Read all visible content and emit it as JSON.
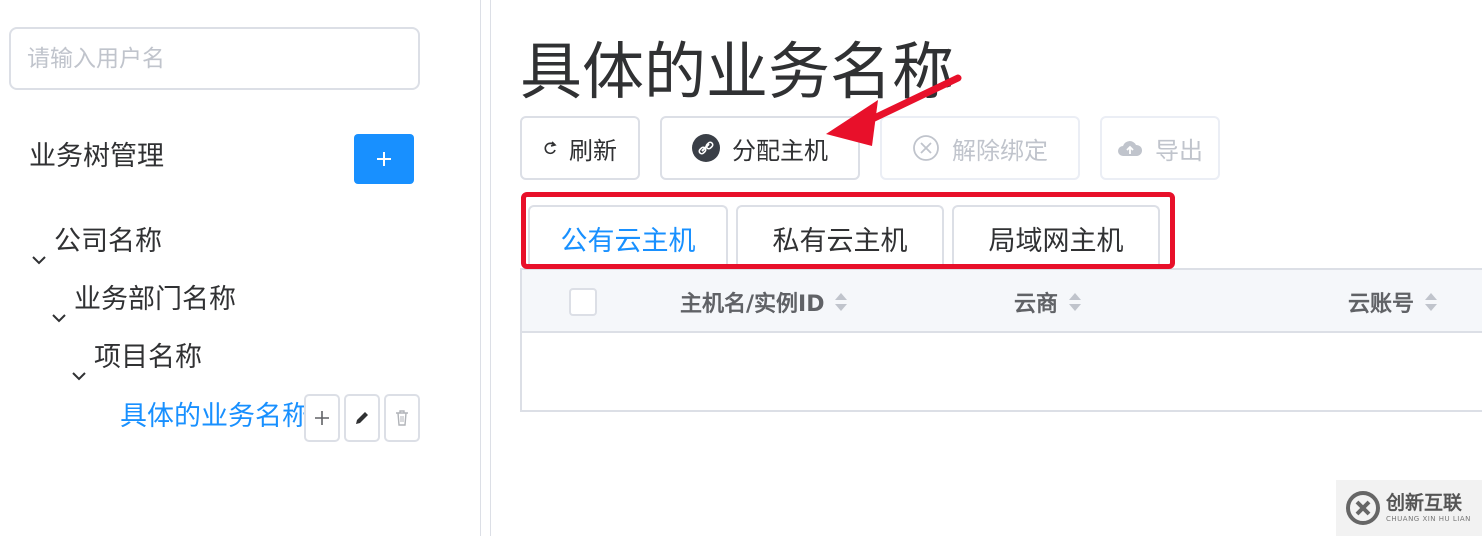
{
  "sidebar": {
    "search": {
      "placeholder": "请输入用户名",
      "value": ""
    },
    "tree_title": "业务树管理",
    "add_root_label": "+",
    "tree": [
      {
        "label": "公司名称",
        "expanded": true
      },
      {
        "label": "业务部门名称",
        "expanded": true
      },
      {
        "label": "项目名称",
        "expanded": true
      }
    ],
    "selected_leaf": {
      "label": "具体的业务名称"
    },
    "leaf_actions": {
      "add_label": "+"
    }
  },
  "main": {
    "title": "具体的业务名称",
    "toolbar": {
      "refresh_label": "刷新",
      "assign_label": "分配主机",
      "unbind_label": "解除绑定",
      "export_label": "导出"
    },
    "tabs": [
      {
        "label": "公有云主机",
        "active": true
      },
      {
        "label": "私有云主机",
        "active": false
      },
      {
        "label": "局域网主机",
        "active": false
      }
    ],
    "table": {
      "columns": [
        {
          "label": "主机名/实例ID",
          "sortable": true
        },
        {
          "label": "云商",
          "sortable": true
        },
        {
          "label": "云账号",
          "sortable": true
        }
      ],
      "rows": []
    }
  },
  "watermark": {
    "brand_cn": "创新互联",
    "brand_en": "CHUANG XIN HU LIAN"
  },
  "colors": {
    "accent": "#1890ff",
    "highlight": "#e8102a",
    "border": "#dcdfe6",
    "header_bg": "#f5f7fa"
  }
}
